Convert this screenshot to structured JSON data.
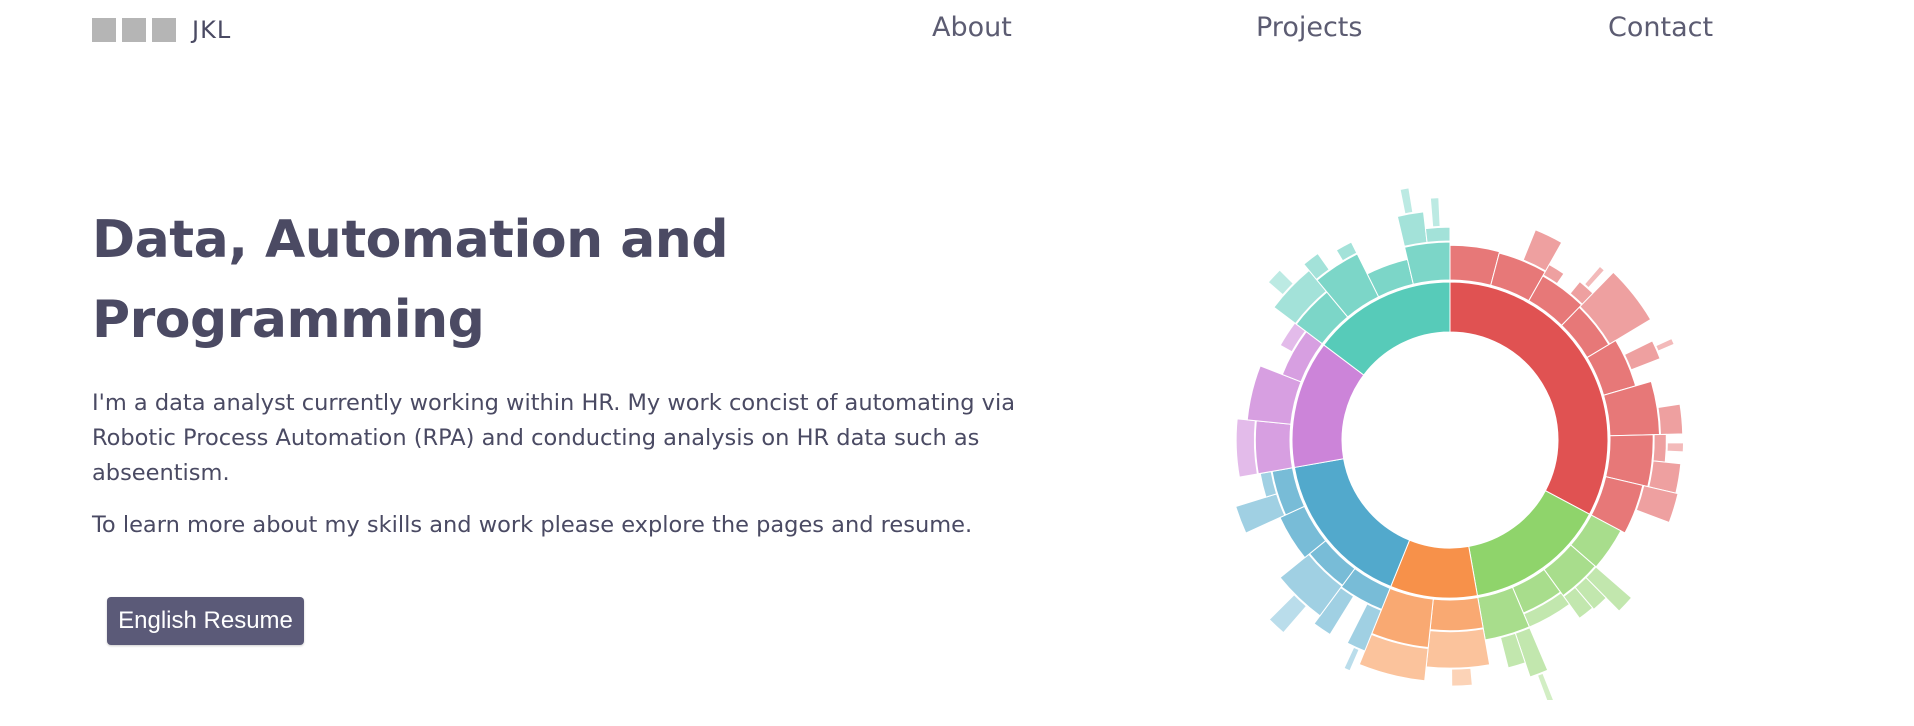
{
  "nav": {
    "brand": "JKL",
    "links": [
      {
        "label": "About"
      },
      {
        "label": "Projects"
      },
      {
        "label": "Contact"
      }
    ]
  },
  "hero": {
    "title_line1": "Data, Automation and",
    "title_line2": "Programming",
    "intro": "I'm a data analyst currently working within HR. My work concist of automating via Robotic Process Automation (RPA) and conducting analysis on HR data such as abseentism.",
    "intro2": "To learn more about my skills and work please explore the pages and resume.",
    "resume_button": "English Resume"
  },
  "colors": {
    "text": "#4a4a63",
    "button": "#5b5a78",
    "logo_square": "#b5b5b5"
  },
  "sunburst": {
    "segments": [
      {
        "name": "red",
        "color": "#e05252",
        "start": 0,
        "end": 118
      },
      {
        "name": "green",
        "color": "#8fd46b",
        "start": 118,
        "end": 170
      },
      {
        "name": "orange",
        "color": "#f7914a",
        "start": 170,
        "end": 202
      },
      {
        "name": "blue",
        "color": "#52a9cc",
        "start": 202,
        "end": 260
      },
      {
        "name": "purple",
        "color": "#cc84d9",
        "start": 260,
        "end": 307
      },
      {
        "name": "teal",
        "color": "#57cbb9",
        "start": 307,
        "end": 360
      }
    ]
  }
}
